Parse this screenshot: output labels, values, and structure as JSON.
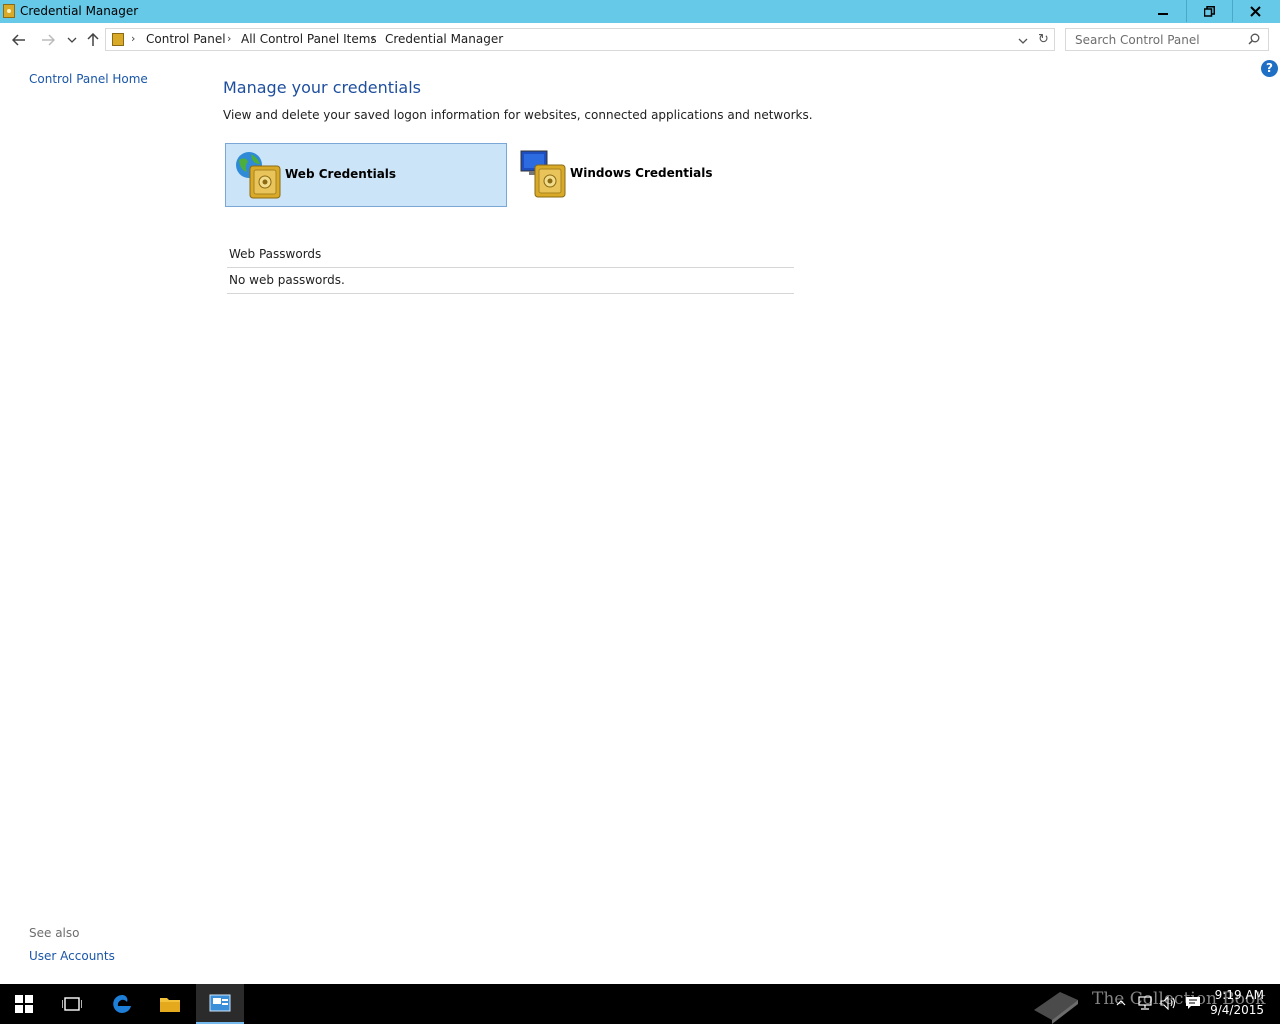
{
  "window": {
    "title": "Credential Manager"
  },
  "address": {
    "crumbs": [
      "Control Panel",
      "All Control Panel Items",
      "Credential Manager"
    ],
    "search_placeholder": "Search Control Panel"
  },
  "left_pane": {
    "home_link": "Control Panel Home",
    "see_also": "See also",
    "user_accounts": "User Accounts"
  },
  "main": {
    "heading": "Manage your credentials",
    "description": "View and delete your saved logon information for websites, connected applications and networks.",
    "tiles": [
      {
        "label": "Web Credentials",
        "selected": true
      },
      {
        "label": "Windows Credentials",
        "selected": false
      }
    ],
    "section_title": "Web Passwords",
    "empty_message": "No web passwords."
  },
  "taskbar": {
    "time": "9:19 AM",
    "date": "9/4/2015",
    "watermark": "The Collection Book"
  },
  "colors": {
    "titlebar": "#66c9e8",
    "link": "#1a56a8",
    "heading": "#1e4e9e",
    "selected_tile": "#cce4f7"
  }
}
